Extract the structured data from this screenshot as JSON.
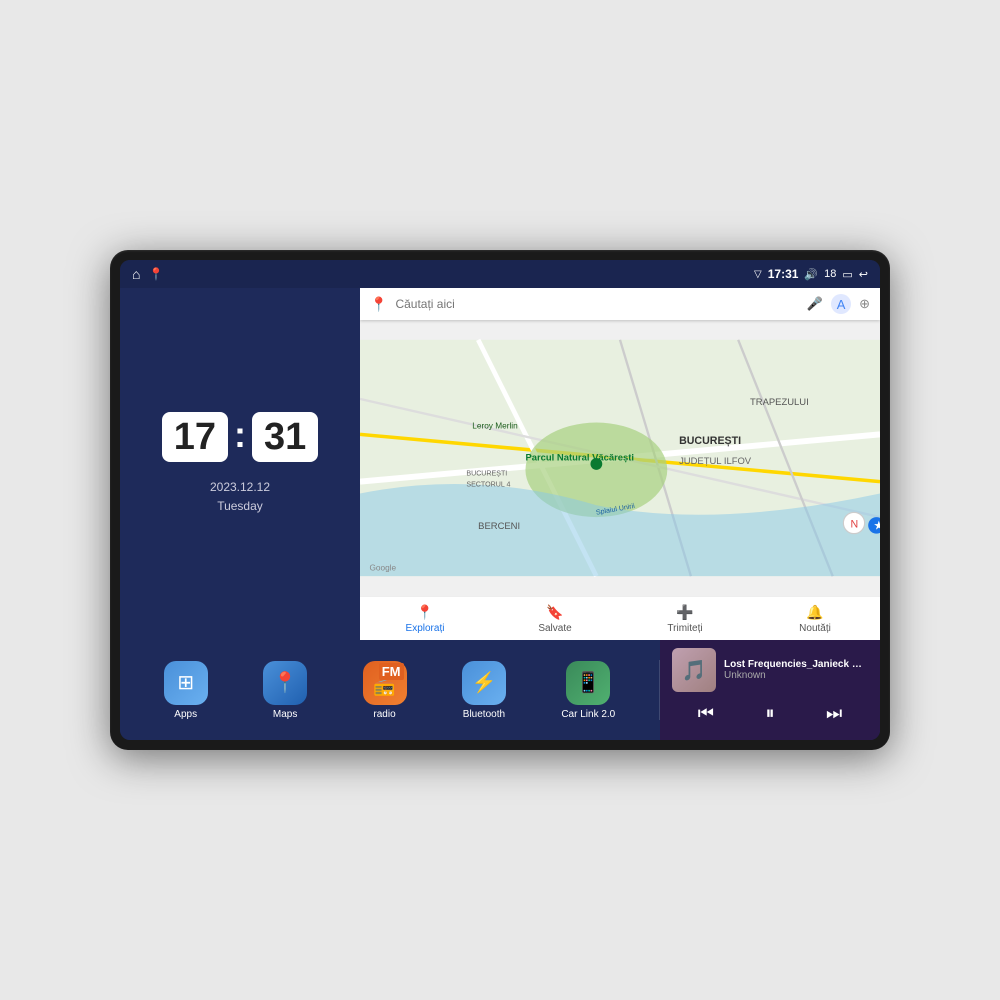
{
  "device": {
    "status_bar": {
      "gps_icon": "▽",
      "time": "17:31",
      "volume_icon": "🔊",
      "battery_level": "18",
      "battery_icon": "▭",
      "back_icon": "↩"
    },
    "nav_icons": {
      "home": "⌂",
      "maps_pin": "📍"
    },
    "clock": {
      "hours": "17",
      "minutes": "31",
      "date": "2023.12.12",
      "day": "Tuesday"
    },
    "map": {
      "search_placeholder": "Căutați aici",
      "nav_items": [
        {
          "label": "Explorați",
          "icon": "📍",
          "active": true
        },
        {
          "label": "Salvate",
          "icon": "🔖",
          "active": false
        },
        {
          "label": "Trimiteți",
          "icon": "⊕",
          "active": false
        },
        {
          "label": "Noutăți",
          "icon": "🔔",
          "active": false
        }
      ],
      "location_labels": [
        "TRAPEZULUI",
        "BUCUREȘTI",
        "JUDEȚUL ILFOV",
        "BERCENI",
        "Parcul Natural Văcărești",
        "Leroy Merlin",
        "BUCUREȘTI SECTORUL 4",
        "Splaiul Unirii"
      ]
    },
    "apps": [
      {
        "id": "apps",
        "label": "Apps",
        "icon": "⊞",
        "color_class": "apps-icon"
      },
      {
        "id": "maps",
        "label": "Maps",
        "icon": "📍",
        "color_class": "maps-icon"
      },
      {
        "id": "radio",
        "label": "radio",
        "icon": "📻",
        "color_class": "radio-icon"
      },
      {
        "id": "bluetooth",
        "label": "Bluetooth",
        "icon": "🔷",
        "color_class": "bluetooth-icon"
      },
      {
        "id": "carlink",
        "label": "Car Link 2.0",
        "icon": "📱",
        "color_class": "carlink-icon"
      }
    ],
    "music": {
      "title": "Lost Frequencies_Janieck Devy-...",
      "artist": "Unknown",
      "thumb_emoji": "🎵"
    }
  }
}
